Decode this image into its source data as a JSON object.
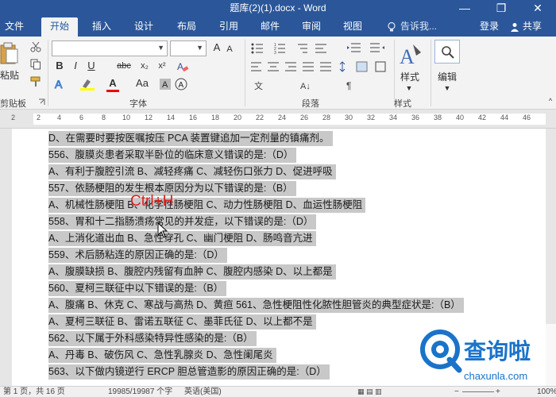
{
  "window": {
    "title": "题库(2)(1).docx - Word",
    "minimize": "—",
    "restore": "❐",
    "close": "✕"
  },
  "tabs": [
    {
      "label": "文件"
    },
    {
      "label": "开始"
    },
    {
      "label": "插入"
    },
    {
      "label": "设计"
    },
    {
      "label": "布局"
    },
    {
      "label": "引用"
    },
    {
      "label": "邮件"
    },
    {
      "label": "审阅"
    },
    {
      "label": "视图"
    }
  ],
  "tell_me": "告诉我...",
  "login": "登录",
  "share": "共享",
  "ribbon": {
    "paste_label": "粘贴",
    "clipboard_label": "剪贴板",
    "font_label": "字体",
    "paragraph_label": "段落",
    "styles_big_label": "样式",
    "styles_group_label": "样式",
    "editing_label": "编辑",
    "bold": "B",
    "italic": "I",
    "underline": "U",
    "strike": "abc",
    "sub": "x₂",
    "sup": "x²",
    "font_color": "A",
    "grow": "A",
    "shrink": "A",
    "aa": "Aa"
  },
  "ruler": {
    "numbers": [
      "2",
      "2",
      "4",
      "6",
      "8",
      "10",
      "12",
      "14",
      "16",
      "18",
      "20",
      "22",
      "24",
      "26",
      "28",
      "30",
      "32",
      "34",
      "36",
      "38",
      "40",
      "42",
      "44",
      "46"
    ]
  },
  "document": {
    "lines": [
      "D、在需要时要按医嘱按压 PCA 装置键追加一定剂量的镇痛剂。",
      "556、腹膜炎患者采取半卧位的临床意义错误的是:（D）",
      "A、有利于腹腔引流    B、减轻疼痛  C、减轻伤口张力  D、促进呼吸",
      "557、依肠梗阻的发生根本原因分为以下错误的是:（B）",
      "A、机械性肠梗阻  B、化学性肠梗阻  C、动力性肠梗阻  D、血运性肠梗阻",
      "558、胃和十二指肠溃疡常见的并发症，以下错误的是:（D）",
      "A、上消化道出血  B、急性穿孔  C、幽门梗阻  D、肠鸣音亢进",
      "559、术后肠粘连的原因正确的是:（D）",
      "A、腹膜缺损  B、腹腔内残留有血肿  C、腹腔内感染    D、以上都是",
      "560、夏柯三联征中以下错误的是:（B）",
      "A、腹痛  B、休克  C、寒战与高热     D、黄疸  561、急性梗阻性化脓性胆管炎的典型症状是:（B）",
      "A、夏柯三联征    B、雷诺五联征    C、墨菲氏征  D、以上都不是",
      "562、以下属于外科感染特异性感染的是:（B）",
      "A、丹毒  B、破伤风    C、急性乳腺炎      D、急性阑尾炎",
      "563、以下做内镜逆行 ERCP 胆总管造影的原因正确的是:（D）"
    ]
  },
  "overlay": {
    "shortcut": "Ctrl+H"
  },
  "watermark": {
    "brand": "查询啦",
    "url": "chaxunla.com"
  },
  "status": {
    "page": "第 1 页，共 16 页",
    "words": "19985/19987 个字",
    "language": "英语(美国)",
    "zoom": "100%"
  },
  "colors": {
    "accent": "#2b579a",
    "highlight": "#c8c8c8",
    "shortcut": "#e02020",
    "watermark": "#1a73c9"
  }
}
